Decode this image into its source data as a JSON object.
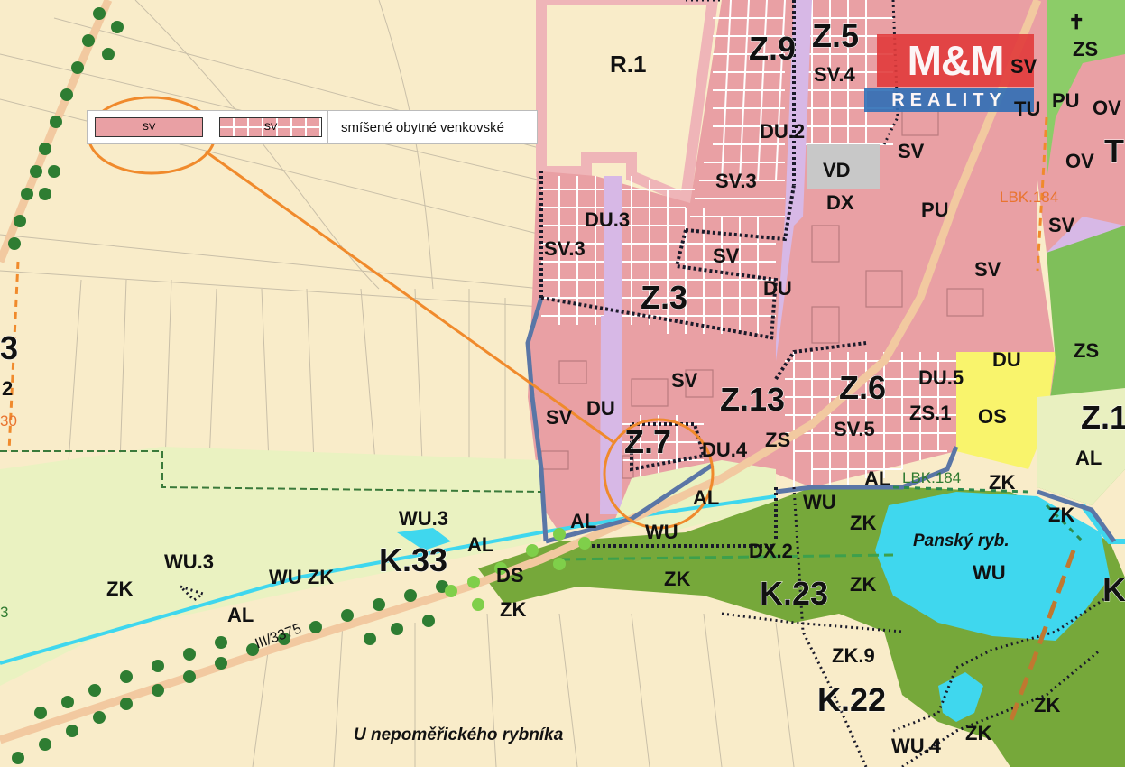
{
  "legend": {
    "swatch_filled": "SV",
    "swatch_hatched": "SV",
    "text": "smíšené obytné venkovské"
  },
  "logo": {
    "main": "M&M",
    "sub": "REALITY"
  },
  "labels": {
    "r1": "R.1",
    "z9": "Z.9",
    "z5": "Z.5",
    "sv4": "SV.4",
    "du2": "DU.2",
    "vd": "VD",
    "dx": "DX",
    "sv3_top": "SV.3",
    "du3": "DU.3",
    "sv3_left": "SV.3",
    "sv_small": "SV",
    "du_mid": "DU",
    "z3": "Z.3",
    "sv_center": "SV",
    "du_lower": "DU",
    "sv_left": "SV",
    "z7": "Z.7",
    "du4": "DU.4",
    "z13": "Z.13",
    "z6": "Z.6",
    "du5": "DU.5",
    "zs1": "ZS.1",
    "os": "OS",
    "du_right": "DU",
    "sv5": "SV.5",
    "zs_mid": "ZS",
    "al_mid": "AL",
    "wu_mid": "WU",
    "al_right": "AL",
    "zk_r1": "ZK",
    "zk_r2": "ZK",
    "zk_r3": "ZK",
    "zs_right": "ZS",
    "z1_edge": "Z.1",
    "al_edge": "AL",
    "pu_top": "PU",
    "pu_mid": "PU",
    "sv_top_right": "SV",
    "sv_r1": "SV",
    "sv_r2": "SV",
    "sv_r3": "SV",
    "tu": "TU",
    "ov1": "OV",
    "ov2": "OV",
    "zs_top": "ZS",
    "t_edge": "T",
    "cross": "✝",
    "lbk184_top": "LBK.184",
    "lbk184_mid": "LBK.184",
    "wu3_a": "WU.3",
    "wu3_b": "WU.3",
    "al_l1": "AL",
    "al_l2": "AL",
    "al_l3": "AL",
    "k33": "K.33",
    "wu_zk": "WU ZK",
    "ds": "DS",
    "zk_l1": "ZK",
    "zk_l2": "ZK",
    "zk_l3": "ZK",
    "wu_s": "WU",
    "dx2": "DX.2",
    "zk_c1": "ZK",
    "k23": "K.23",
    "zk_c2": "ZK",
    "zk9": "ZK.9",
    "k22": "K.22",
    "wu4": "WU.4",
    "zk_b1": "ZK",
    "zk_b2": "ZK",
    "pond_name": "Panský ryb.",
    "pond_wu": "WU",
    "k_edge": "K",
    "road": "III/3375",
    "place": "U nepoměřického rybníka",
    "edge3": "3",
    "edge2": "2",
    "edge30": "30",
    "edge3b": "3"
  },
  "colors": {
    "background": "#f9ecc9",
    "residential": "#e9a0a4",
    "meadow": "#e9f0c0",
    "forest": "#76a83a",
    "water": "#3fd7ee",
    "civic": "#d7b8e6",
    "sport": "#f9f46c",
    "orange": "#f08a2c"
  }
}
